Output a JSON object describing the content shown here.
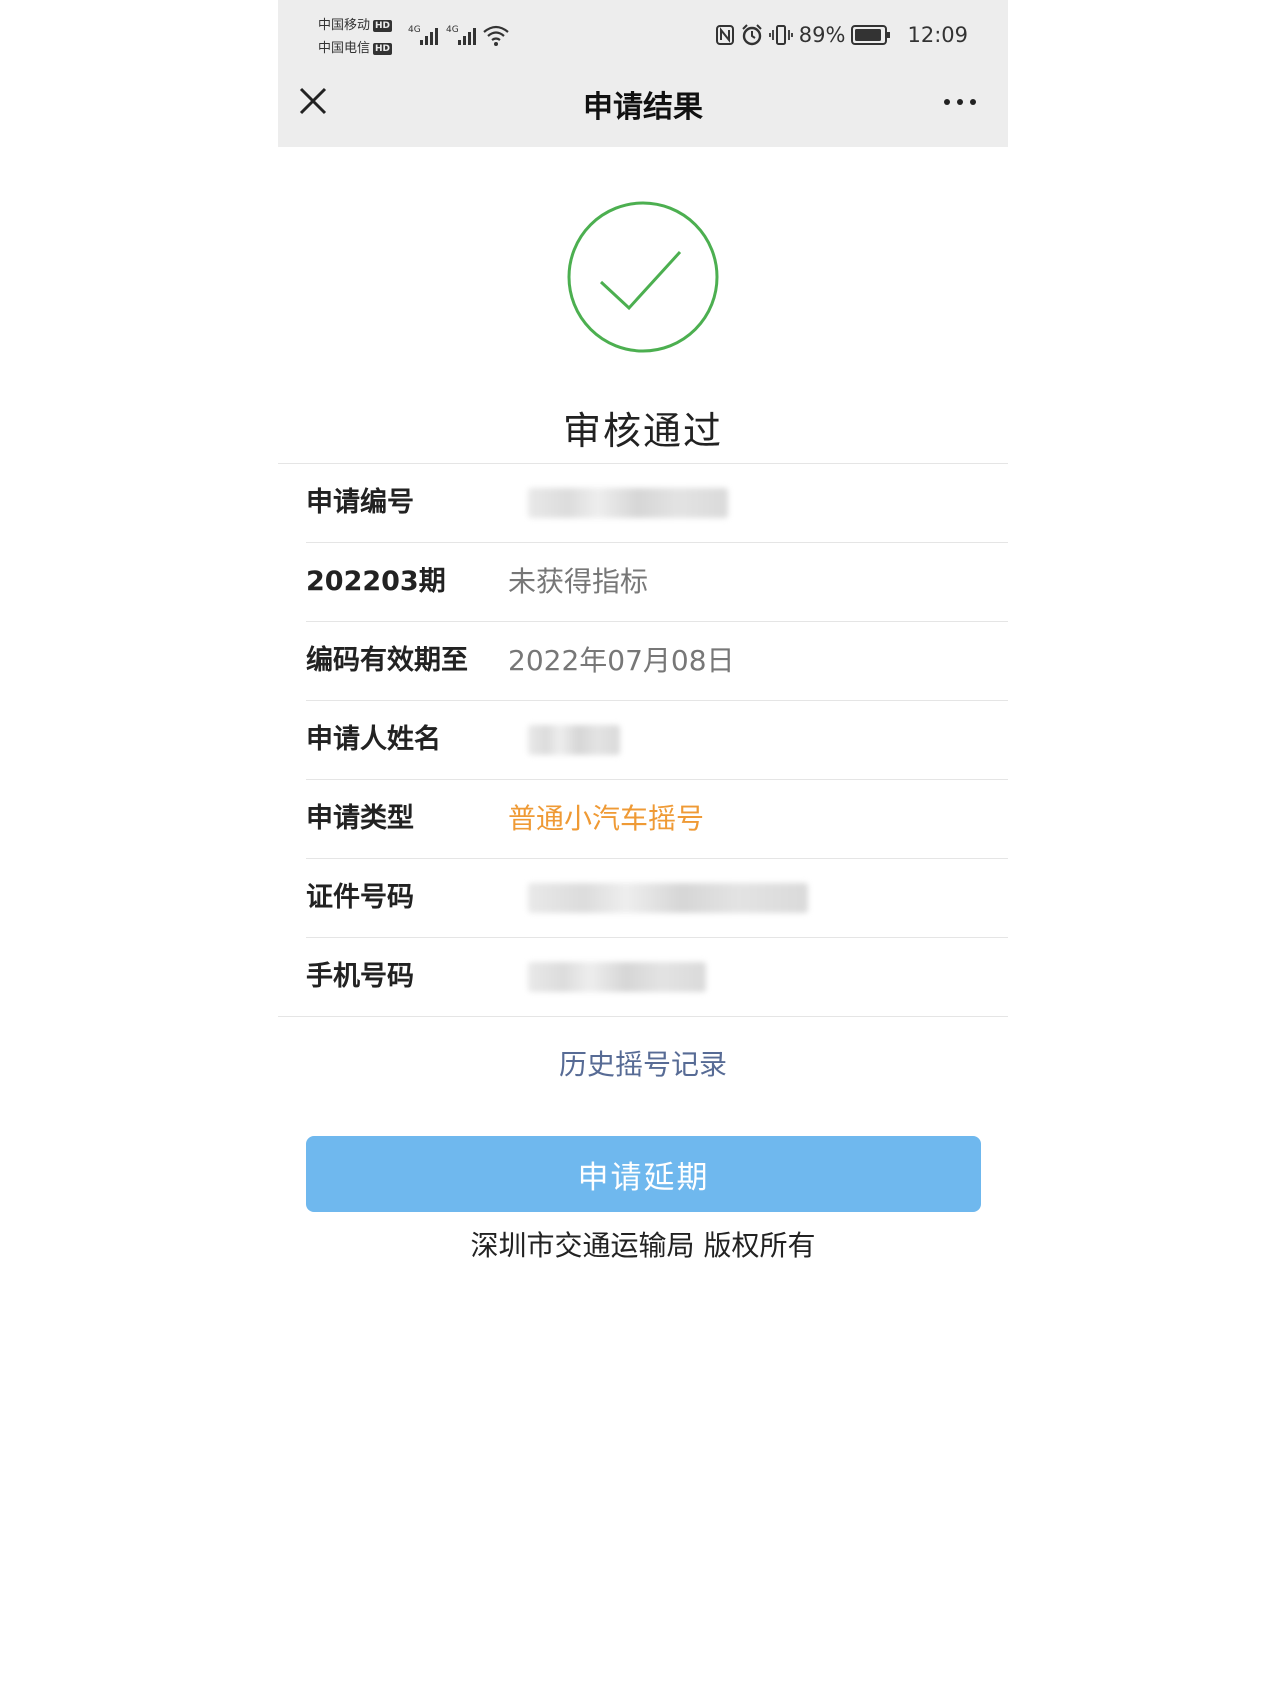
{
  "status_bar": {
    "carrier1": "中国移动",
    "carrier2": "中国电信",
    "hd_badge": "HD",
    "network": "4G",
    "battery": "89%",
    "time": "12:09"
  },
  "nav": {
    "title": "申请结果",
    "close_icon": "close-icon",
    "more_icon": "more-icon"
  },
  "result": {
    "status_text": "审核通过",
    "icon": "check-circle-icon",
    "icon_color": "#4caf50"
  },
  "details": [
    {
      "label": "申请编号",
      "value": ""
    },
    {
      "label": "202203期",
      "value": "未获得指标"
    },
    {
      "label": "编码有效期至",
      "value": "2022年07月08日"
    },
    {
      "label": "申请人姓名",
      "value": ""
    },
    {
      "label": "申请类型",
      "value": "普通小汽车摇号"
    },
    {
      "label": "证件号码",
      "value": ""
    },
    {
      "label": "手机号码",
      "value": ""
    }
  ],
  "links": {
    "history": "历史摇号记录"
  },
  "actions": {
    "extend_label": "申请延期",
    "extend_color": "#6fb8ee"
  },
  "footer": {
    "copyright": "深圳市交通运输局 版权所有"
  },
  "colors": {
    "accent_orange": "#ef9a35",
    "link_blue": "#576b95"
  }
}
